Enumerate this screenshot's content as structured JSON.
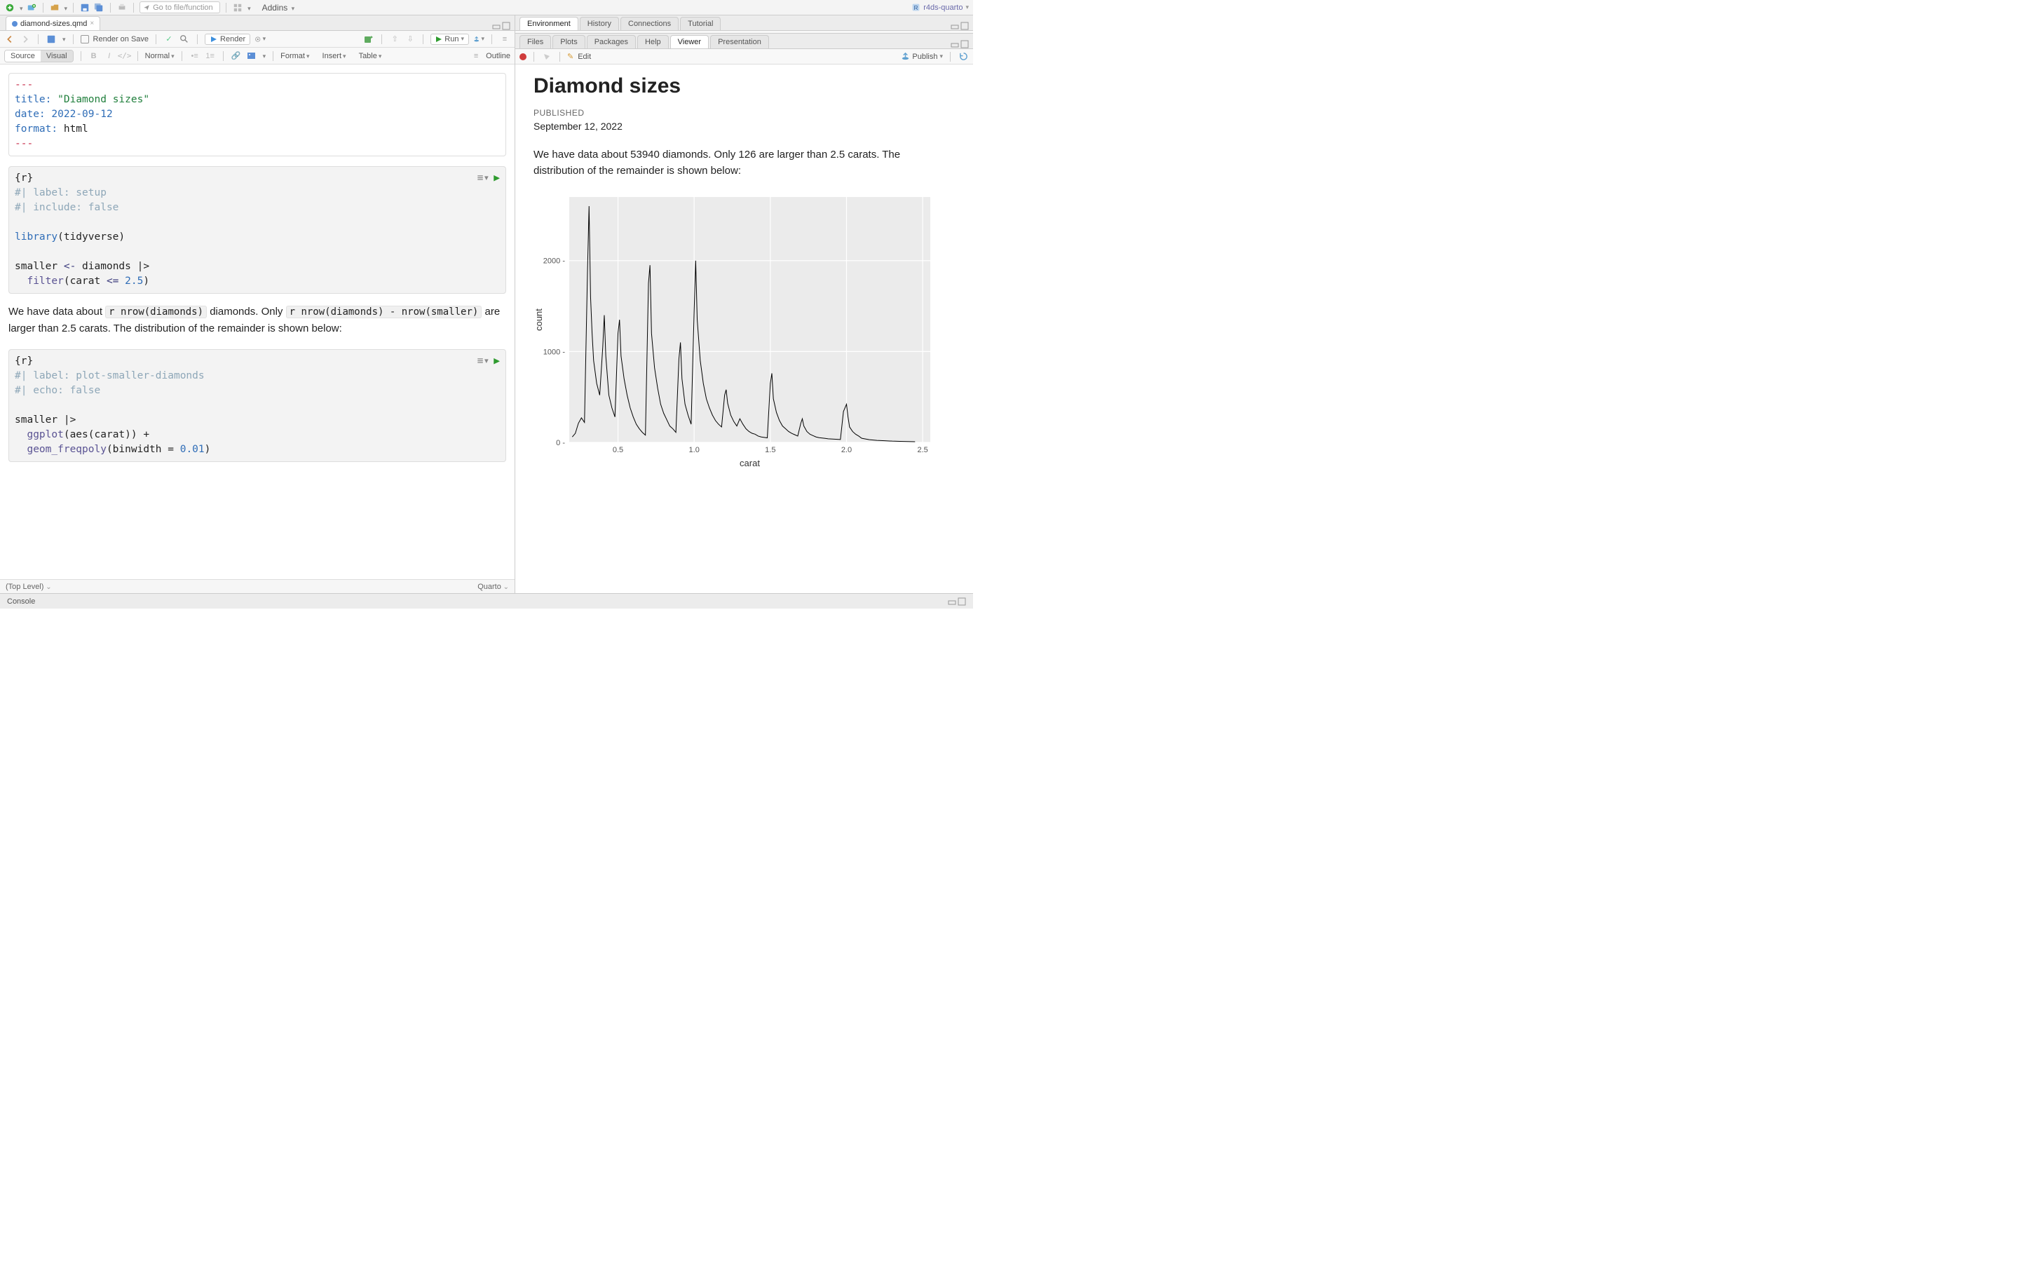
{
  "main_toolbar": {
    "goto_placeholder": "Go to file/function",
    "addins_label": "Addins",
    "project_name": "r4ds-quarto"
  },
  "editor": {
    "tab_filename": "diamond-sizes.qmd",
    "render_on_save": "Render on Save",
    "render_btn": "Render",
    "run_btn": "Run",
    "source_label": "Source",
    "visual_label": "Visual",
    "normal_label": "Normal",
    "format_label": "Format",
    "insert_label": "Insert",
    "table_label": "Table",
    "outline_label": "Outline",
    "footer_scope": "(Top Level)",
    "footer_lang": "Quarto"
  },
  "code": {
    "yaml_open": "---",
    "yaml_title_key": "title:",
    "yaml_title_val": "\"Diamond sizes\"",
    "yaml_date_key": "date:",
    "yaml_date_val": "2022-09-12",
    "yaml_format_key": "format:",
    "yaml_format_val": "html",
    "yaml_close": "---",
    "chunk1_hdr": "{r}",
    "chunk1_c1": "#| label: setup",
    "chunk1_c2": "#| include: false",
    "chunk1_lib": "library",
    "chunk1_libarg": "(tidyverse)",
    "chunk1_l3a": "smaller ",
    "chunk1_l3b": "<-",
    "chunk1_l3c": " diamonds |>",
    "chunk1_l4a": "  filter",
    "chunk1_l4b": "(carat ",
    "chunk1_l4c": "<=",
    "chunk1_l4d": " 2.5",
    "chunk1_l4e": ")",
    "para_1": "We have data about ",
    "inline1": "r nrow(diamonds)",
    "para_2": " diamonds. Only ",
    "inline2": "r nrow(diamonds) - nrow(smaller)",
    "para_3": " are larger than 2.5 carats. The distribution of the remainder is shown below:",
    "chunk2_hdr": "{r}",
    "chunk2_c1": "#| label: plot-smaller-diamonds",
    "chunk2_c2": "#| echo: false",
    "chunk2_l1": "smaller |>",
    "chunk2_l2a": "  ggplot",
    "chunk2_l2b": "(aes(",
    "chunk2_l2c": "carat",
    "chunk2_l2d": ")) +",
    "chunk2_l3a": "  geom_freqpoly",
    "chunk2_l3b": "(binwidth = ",
    "chunk2_l3c": "0.01",
    "chunk2_l3d": ")"
  },
  "right": {
    "top_tabs": [
      "Environment",
      "History",
      "Connections",
      "Tutorial"
    ],
    "mid_tabs": [
      "Files",
      "Plots",
      "Packages",
      "Help",
      "Viewer",
      "Presentation"
    ],
    "mid_active_index": 4,
    "edit_label": "Edit",
    "publish_label": "Publish"
  },
  "document": {
    "title": "Diamond sizes",
    "published_label": "PUBLISHED",
    "published_date": "September 12, 2022",
    "paragraph": "We have data about 53940 diamonds. Only 126 are larger than 2.5 carats. The distribution of the remainder is shown below:"
  },
  "console_label": "Console",
  "chart_data": {
    "type": "line",
    "title": "",
    "xlabel": "carat",
    "ylabel": "count",
    "xlim": [
      0.18,
      2.55
    ],
    "ylim": [
      0,
      2700
    ],
    "x_ticks": [
      0.5,
      1.0,
      1.5,
      2.0,
      2.5
    ],
    "y_ticks": [
      0,
      1000,
      2000
    ],
    "x": [
      0.2,
      0.22,
      0.24,
      0.26,
      0.28,
      0.3,
      0.31,
      0.32,
      0.33,
      0.34,
      0.36,
      0.38,
      0.4,
      0.41,
      0.42,
      0.44,
      0.46,
      0.48,
      0.5,
      0.51,
      0.52,
      0.54,
      0.56,
      0.58,
      0.6,
      0.62,
      0.64,
      0.66,
      0.68,
      0.7,
      0.71,
      0.72,
      0.74,
      0.76,
      0.78,
      0.8,
      0.82,
      0.84,
      0.86,
      0.88,
      0.9,
      0.91,
      0.92,
      0.94,
      0.96,
      0.98,
      1.0,
      1.01,
      1.02,
      1.04,
      1.06,
      1.08,
      1.1,
      1.12,
      1.14,
      1.16,
      1.18,
      1.2,
      1.21,
      1.22,
      1.24,
      1.26,
      1.28,
      1.3,
      1.32,
      1.34,
      1.36,
      1.38,
      1.4,
      1.42,
      1.44,
      1.46,
      1.48,
      1.5,
      1.51,
      1.52,
      1.54,
      1.56,
      1.58,
      1.6,
      1.62,
      1.64,
      1.66,
      1.68,
      1.7,
      1.71,
      1.72,
      1.74,
      1.76,
      1.78,
      1.8,
      1.82,
      1.84,
      1.86,
      1.88,
      1.9,
      1.92,
      1.94,
      1.96,
      1.98,
      2.0,
      2.01,
      2.02,
      2.04,
      2.06,
      2.08,
      2.1,
      2.15,
      2.2,
      2.25,
      2.3,
      2.35,
      2.4,
      2.45,
      2.5
    ],
    "values": [
      60,
      100,
      210,
      270,
      220,
      1900,
      2600,
      1600,
      1200,
      900,
      650,
      520,
      1050,
      1400,
      950,
      520,
      380,
      280,
      1200,
      1350,
      950,
      700,
      520,
      380,
      280,
      200,
      150,
      110,
      80,
      1750,
      1950,
      1200,
      820,
      600,
      420,
      320,
      250,
      180,
      150,
      110,
      920,
      1100,
      700,
      420,
      300,
      200,
      1450,
      2000,
      1350,
      900,
      650,
      480,
      380,
      300,
      240,
      200,
      170,
      520,
      580,
      430,
      300,
      230,
      180,
      260,
      200,
      150,
      120,
      100,
      90,
      70,
      60,
      55,
      50,
      650,
      760,
      480,
      330,
      240,
      180,
      150,
      120,
      100,
      85,
      70,
      210,
      260,
      180,
      120,
      90,
      75,
      60,
      52,
      48,
      44,
      40,
      38,
      36,
      34,
      32,
      340,
      420,
      280,
      170,
      120,
      90,
      70,
      45,
      30,
      22,
      18,
      14,
      12,
      10,
      8
    ]
  }
}
